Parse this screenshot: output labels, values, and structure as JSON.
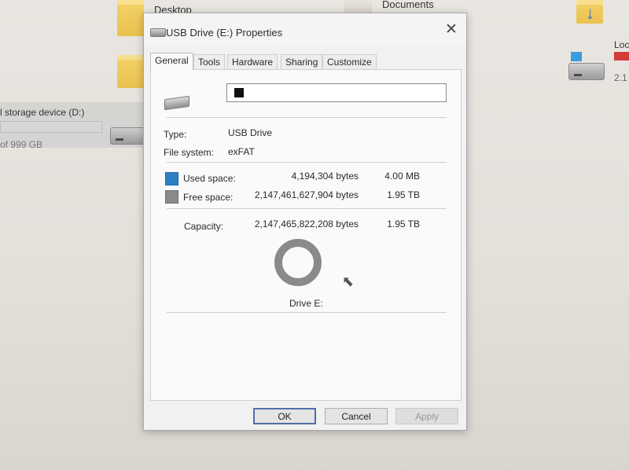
{
  "desktop": {
    "items": [
      {
        "label": "Desktop"
      },
      {
        "label": "Documents"
      },
      {
        "label": "Loc"
      },
      {
        "label": "2.1"
      }
    ],
    "drive_d": {
      "label": "l storage device (D:)",
      "size": "of 999 GB"
    }
  },
  "dialog": {
    "title": "USB Drive (E:) Properties",
    "close_glyph": "✕",
    "tabs": [
      {
        "label": "General",
        "active": true
      },
      {
        "label": "Tools"
      },
      {
        "label": "Hardware"
      },
      {
        "label": "Sharing"
      },
      {
        "label": "Customize"
      }
    ],
    "general": {
      "volume_name": "",
      "type_label": "Type:",
      "type_value": "USB Drive",
      "fs_label": "File system:",
      "fs_value": "exFAT",
      "used_label": "Used space:",
      "used_bytes": "4,194,304 bytes",
      "used_size": "4.00 MB",
      "free_label": "Free space:",
      "free_bytes": "2,147,461,627,904 bytes",
      "free_size": "1.95 TB",
      "capacity_label": "Capacity:",
      "capacity_bytes": "2,147,465,822,208 bytes",
      "capacity_size": "1.95 TB",
      "drive_label": "Drive E:",
      "used_fraction": 2e-06
    },
    "buttons": {
      "ok": "OK",
      "cancel": "Cancel",
      "apply": "Apply"
    },
    "colors": {
      "used": "#2d7fc2",
      "free": "#8a8a8a"
    }
  }
}
